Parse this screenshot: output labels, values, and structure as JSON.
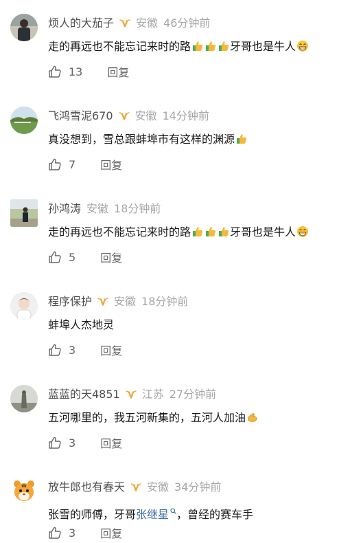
{
  "comments": [
    {
      "name": "烦人的大茄子",
      "vip": true,
      "location": "安徽",
      "time": "46分钟前",
      "text_parts": [
        "走的再远也不能忘记来时的路",
        "牙哥也是牛人"
      ],
      "likes": "13",
      "reply_label": "回复",
      "avatar": "avatar-person-icon",
      "emoji": [
        "thumbs-up-icon",
        "thumbs-up-icon",
        "thumbs-up-icon",
        "grin-icon"
      ]
    },
    {
      "name": "飞鸿雪泥670",
      "vip": true,
      "location": "安徽",
      "time": "14分钟前",
      "text_parts": [
        "真没想到，雪总跟蚌埠市有这样的渊源"
      ],
      "likes": "7",
      "reply_label": "回复",
      "avatar": "avatar-landscape-icon",
      "emoji": [
        "thumbs-up-icon"
      ]
    },
    {
      "name": "孙鸿涛",
      "vip": false,
      "location": "安徽",
      "time": "18分钟前",
      "text_parts": [
        "走的再远也不能忘记来时的路",
        "牙哥也是牛人"
      ],
      "likes": "5",
      "reply_label": "回复",
      "avatar": "avatar-person-outdoor-icon",
      "emoji": [
        "thumbs-up-icon",
        "thumbs-up-icon",
        "thumbs-up-icon",
        "grin-icon"
      ]
    },
    {
      "name": "程序保护",
      "vip": true,
      "location": "安徽",
      "time": "18分钟前",
      "text_parts": [
        "蚌埠人杰地灵"
      ],
      "likes": "3",
      "reply_label": "回复",
      "avatar": "avatar-child-icon",
      "emoji": []
    },
    {
      "name": "蓝蓝的天4851",
      "vip": true,
      "location": "江苏",
      "time": "27分钟前",
      "text_parts": [
        "五河哪里的，我五河新集的，五河人加油"
      ],
      "likes": "3",
      "reply_label": "回复",
      "avatar": "avatar-statue-icon",
      "emoji": [
        "muscle-icon"
      ]
    },
    {
      "name": "放牛郎也有春天",
      "vip": true,
      "location": "安徽",
      "time": "34分钟前",
      "text_parts": [
        "张雪的师傅，牙哥",
        "张继星",
        "，曾经的赛车手"
      ],
      "likes": "3",
      "reply_label": "回复",
      "avatar": "avatar-tiger-icon",
      "emoji": [
        "search-icon"
      ]
    }
  ],
  "colors": {
    "name": "#4f4f4f",
    "meta": "#a6a6a6",
    "text": "#191919",
    "link": "#3b6ea5",
    "vip": "#f0a83a"
  }
}
